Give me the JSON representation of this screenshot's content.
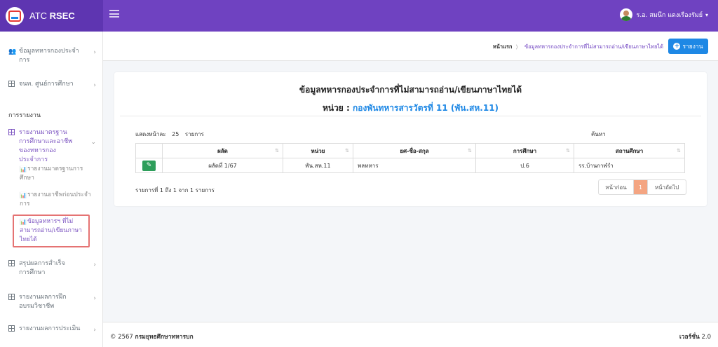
{
  "brand": {
    "name_prefix": "ATC",
    "name_bold": "RSEC"
  },
  "user": {
    "name": "ร.อ. สมนึก แดงเรืองรัมย์"
  },
  "sidebar": {
    "items": [
      {
        "label": "ข้อมูลทหารกองประจำการ"
      },
      {
        "label": "จนท. ศูนย์การศึกษา"
      }
    ],
    "section_header": "การรายงาน",
    "report_group": {
      "label": "รายงานมาตรฐานการศึกษาและอาชีพของทหารกองประจำการ"
    },
    "sub_items": [
      {
        "label": "รายงานมาตรฐานการศึกษา"
      },
      {
        "label": "รายงานอาชีพก่อนประจำการ"
      },
      {
        "label": "ข้อมูลทหารฯ ที่ไม่สามารถอ่าน/เขียนภาษาไทยได้"
      }
    ],
    "bottom_items": [
      {
        "label": "สรุปผลการสำเร็จการศึกษา"
      },
      {
        "label": "รายงานผลการฝึกอบรมวิชาชีพ"
      },
      {
        "label": "รายงานผลการประเมิน"
      }
    ]
  },
  "breadcrumb": {
    "home": "หน้าแรก",
    "separator": "〉",
    "current": "ข้อมูลทหารกองประจำการที่ไม่สามารถอ่าน/เขียนภาษาไทยได้"
  },
  "toolbar": {
    "report_label": "รายงาน"
  },
  "card": {
    "title": "ข้อมูลทหารกองประจำการที่ไม่สามารถอ่าน/เขียนภาษาไทยได้",
    "unit_label": "หน่วย : ",
    "unit_value": "กองพันทหารสารวัตรที่ 11 (พัน.สห.11)"
  },
  "datatable": {
    "show_prefix": "แสดงหน้าละ",
    "page_size": "25",
    "show_suffix": "รายการ",
    "search_label": "ค้นหา",
    "columns": [
      "",
      "ผลัด",
      "หน่วย",
      "ยศ-ชื่อ-สกุล",
      "การศึกษา",
      "สถานศึกษา"
    ],
    "rows": [
      {
        "batch": "ผลัดที่ 1/67",
        "unit": "พัน.สห.11",
        "name": "พลทหาร",
        "education": "ป.6",
        "school": "รร.บ้านกาฬรำ"
      }
    ],
    "info": "รายการที่ 1 ถึง 1 จาก 1 รายการ",
    "pager": {
      "prev": "หน้าก่อน",
      "current": "1",
      "next": "หน้าถัดไป"
    }
  },
  "footer": {
    "copy_prefix": "© 2567 ",
    "copy_org": "กรมยุทธศึกษาทหารบก",
    "version_label": "เวอร์ชั่น",
    "version": " 2.0"
  }
}
